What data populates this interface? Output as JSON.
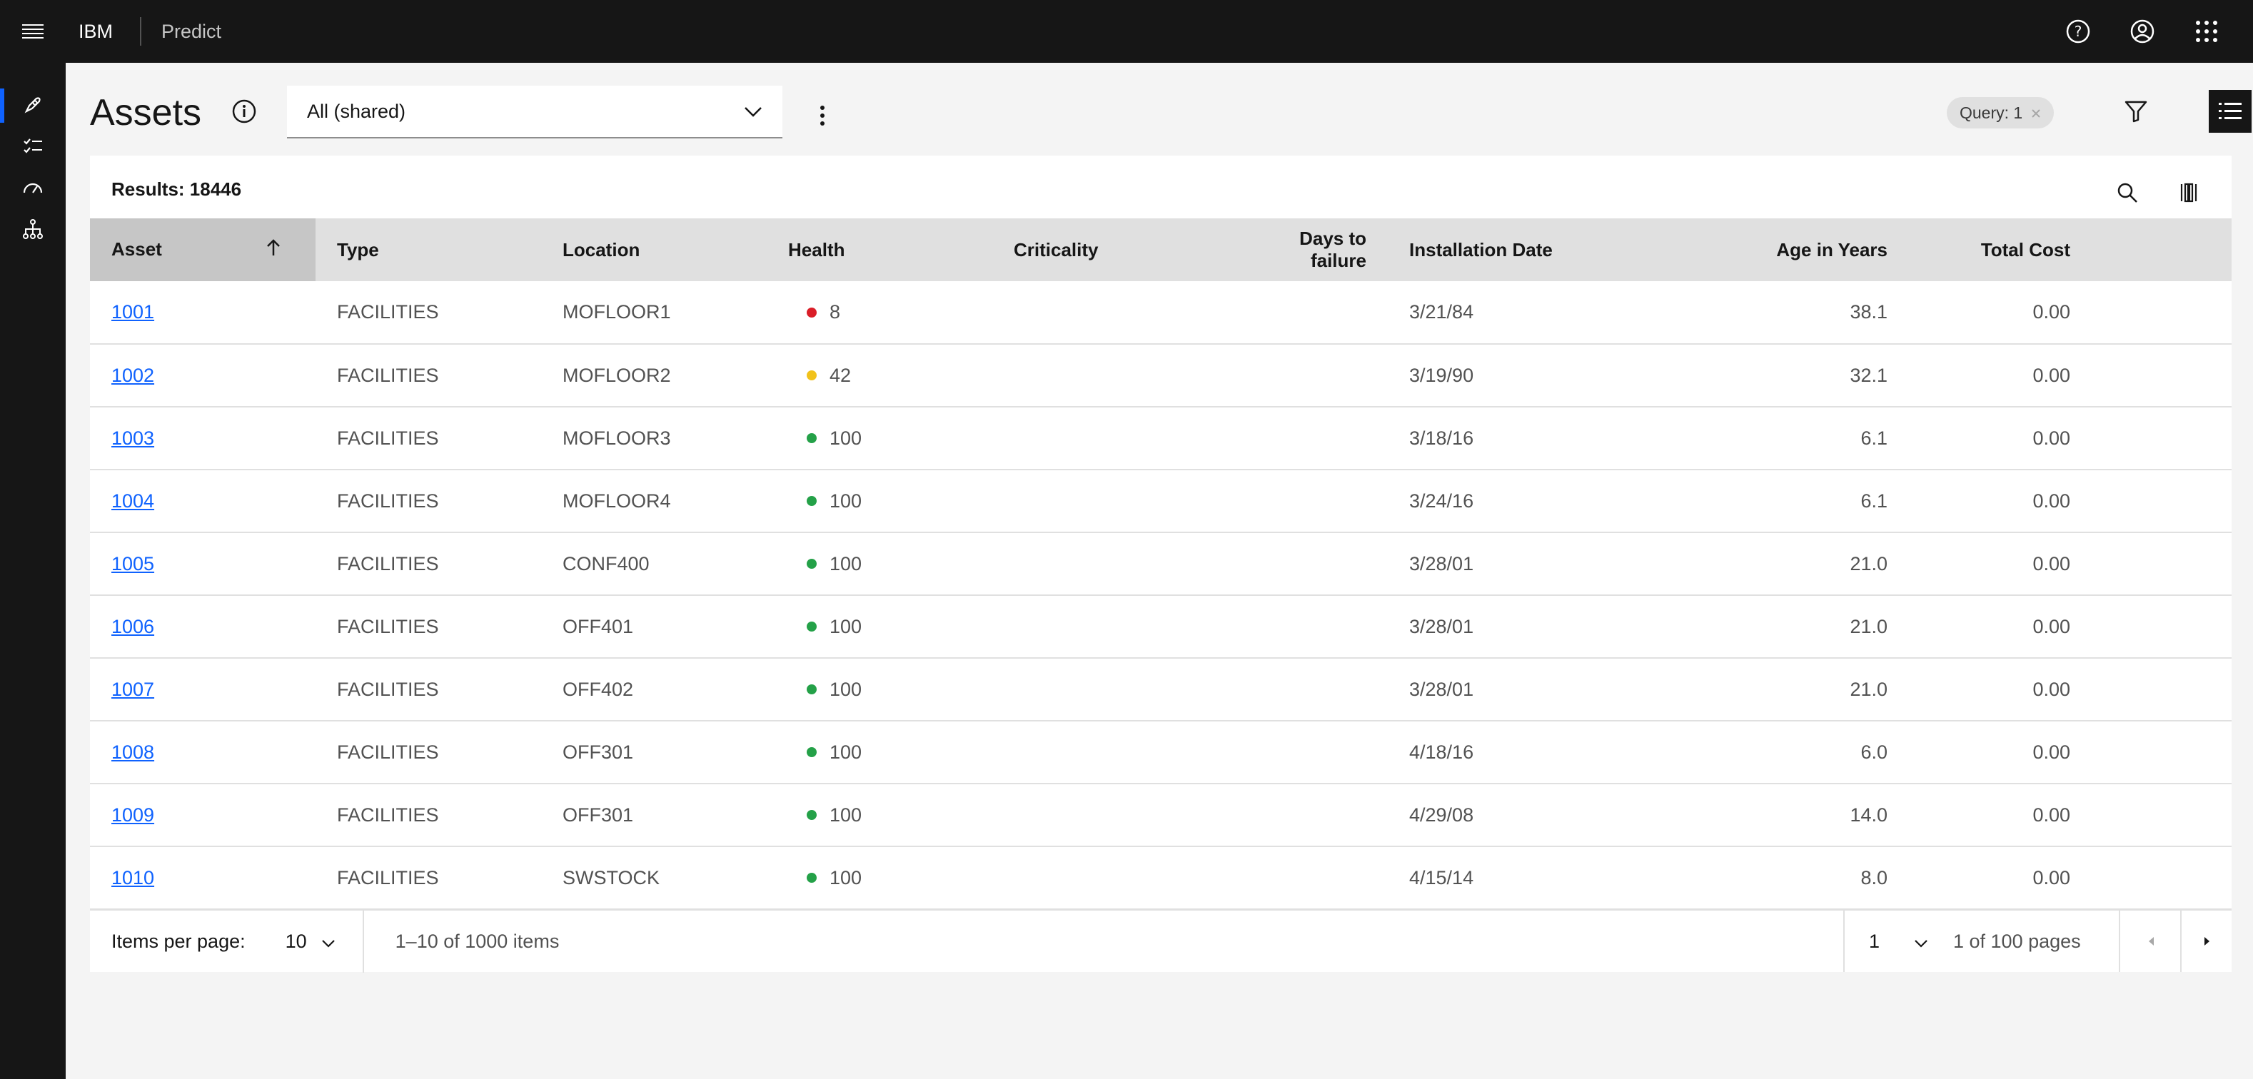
{
  "header": {
    "brand": "IBM",
    "product": "Predict",
    "icons": [
      "menu-icon",
      "help-icon",
      "user-icon",
      "app-switcher-icon"
    ]
  },
  "rail": {
    "icons": [
      "rocket-icon",
      "checklist-icon",
      "gauge-icon",
      "hierarchy-icon"
    ]
  },
  "page": {
    "title": "Assets",
    "view_select": "All (shared)",
    "query_tag": "Query: 1"
  },
  "table": {
    "results_label": "Results: 18446",
    "columns": [
      "Asset",
      "Type",
      "Location",
      "Health",
      "Criticality",
      "Days to failure",
      "Installation Date",
      "Age in Years",
      "Total Cost"
    ],
    "rows": [
      {
        "asset": "1001",
        "type": "FACILITIES",
        "location": "MOFLOOR1",
        "health": "8",
        "health_color": "#da1e28",
        "criticality": "",
        "days": "",
        "install": "3/21/84",
        "age": "38.1",
        "cost": "0.00"
      },
      {
        "asset": "1002",
        "type": "FACILITIES",
        "location": "MOFLOOR2",
        "health": "42",
        "health_color": "#f1c21b",
        "criticality": "",
        "days": "",
        "install": "3/19/90",
        "age": "32.1",
        "cost": "0.00"
      },
      {
        "asset": "1003",
        "type": "FACILITIES",
        "location": "MOFLOOR3",
        "health": "100",
        "health_color": "#24a148",
        "criticality": "",
        "days": "",
        "install": "3/18/16",
        "age": "6.1",
        "cost": "0.00"
      },
      {
        "asset": "1004",
        "type": "FACILITIES",
        "location": "MOFLOOR4",
        "health": "100",
        "health_color": "#24a148",
        "criticality": "",
        "days": "",
        "install": "3/24/16",
        "age": "6.1",
        "cost": "0.00"
      },
      {
        "asset": "1005",
        "type": "FACILITIES",
        "location": "CONF400",
        "health": "100",
        "health_color": "#24a148",
        "criticality": "",
        "days": "",
        "install": "3/28/01",
        "age": "21.0",
        "cost": "0.00"
      },
      {
        "asset": "1006",
        "type": "FACILITIES",
        "location": "OFF401",
        "health": "100",
        "health_color": "#24a148",
        "criticality": "",
        "days": "",
        "install": "3/28/01",
        "age": "21.0",
        "cost": "0.00"
      },
      {
        "asset": "1007",
        "type": "FACILITIES",
        "location": "OFF402",
        "health": "100",
        "health_color": "#24a148",
        "criticality": "",
        "days": "",
        "install": "3/28/01",
        "age": "21.0",
        "cost": "0.00"
      },
      {
        "asset": "1008",
        "type": "FACILITIES",
        "location": "OFF301",
        "health": "100",
        "health_color": "#24a148",
        "criticality": "",
        "days": "",
        "install": "4/18/16",
        "age": "6.0",
        "cost": "0.00"
      },
      {
        "asset": "1009",
        "type": "FACILITIES",
        "location": "OFF301",
        "health": "100",
        "health_color": "#24a148",
        "criticality": "",
        "days": "",
        "install": "4/29/08",
        "age": "14.0",
        "cost": "0.00"
      },
      {
        "asset": "1010",
        "type": "FACILITIES",
        "location": "SWSTOCK",
        "health": "100",
        "health_color": "#24a148",
        "criticality": "",
        "days": "",
        "install": "4/15/14",
        "age": "8.0",
        "cost": "0.00"
      }
    ]
  },
  "pagination": {
    "items_per_page_label": "Items per page:",
    "items_per_page": "10",
    "range": "1–10 of 1000 items",
    "page": "1",
    "of_pages": "1 of 100 pages"
  },
  "colors": {
    "link": "#0f62fe",
    "header_bg": "#161616"
  }
}
